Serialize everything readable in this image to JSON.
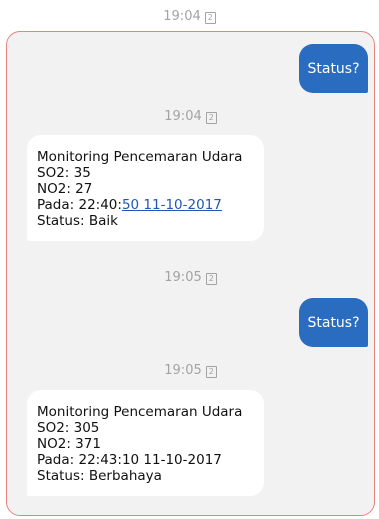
{
  "top_timestamp": "19:04",
  "sim_label": "2",
  "messages": [
    {
      "type": "outgoing",
      "text": "Status?"
    },
    {
      "type": "timestamp",
      "time": "19:04"
    },
    {
      "type": "incoming",
      "lines": [
        "Monitoring Pencemaran Udara",
        "SO2: 35",
        "NO2: 27"
      ],
      "pada_prefix": "Pada: 22:40:",
      "pada_link": "50 11-10-2017",
      "status": "Status: Baik"
    },
    {
      "type": "timestamp",
      "time": "19:05"
    },
    {
      "type": "outgoing",
      "text": "Status?"
    },
    {
      "type": "timestamp",
      "time": "19:05"
    },
    {
      "type": "incoming",
      "lines": [
        "Monitoring Pencemaran Udara",
        "SO2: 305",
        "NO2: 371",
        "Pada: 22:43:10 11-10-2017",
        "Status: Berbahaya"
      ]
    }
  ],
  "colors": {
    "outgoing_bubble": "#2a6cbf",
    "thread_border": "#e6827f",
    "link": "#2256b8"
  },
  "icons": {
    "sim": "sim-card-icon"
  }
}
